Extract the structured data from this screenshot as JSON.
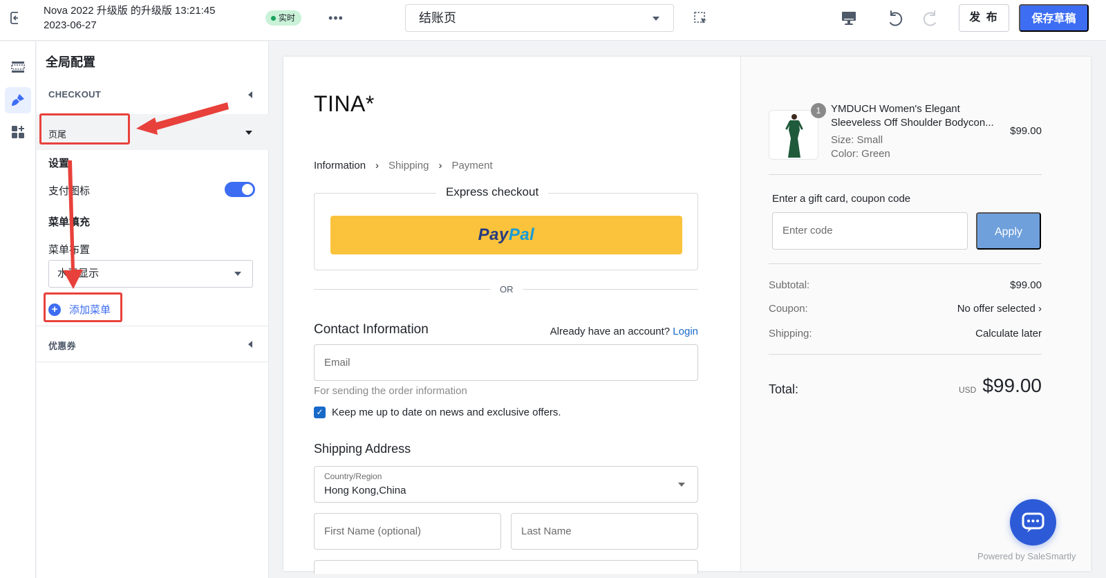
{
  "topbar": {
    "exit_icon": "exit-icon",
    "title": "Nova 2022 升级版 的升级版 13:21:45",
    "date": "2023-06-27",
    "live_badge": "实时",
    "more": "•••",
    "page_select": "结账页",
    "publish": "发 布",
    "save_draft": "保存草稿",
    "icons": [
      "select-area-icon",
      "desktop-preview-icon",
      "undo-icon",
      "redo-icon"
    ]
  },
  "rail": {
    "items": [
      "sections-icon",
      "theme-brush-icon",
      "add-app-icon"
    ]
  },
  "panel": {
    "title": "全局配置",
    "checkout_section": "CHECKOUT",
    "footer_row": "页尾",
    "settings": "设置",
    "payment_icon": "支付图标",
    "payment_icon_on": true,
    "menu_fill": "菜单填充",
    "menu_layout": "菜单布置",
    "menu_layout_value": "水平显示",
    "add_menu": "添加菜单",
    "coupon_section": "优惠券"
  },
  "checkout": {
    "brand": "TINA*",
    "breadcrumbs": [
      "Information",
      "Shipping",
      "Payment"
    ],
    "express_label": "Express checkout",
    "paypal_a": "Pay",
    "paypal_b": "Pal",
    "or": "OR",
    "contact_title": "Contact Information",
    "account_prompt": "Already have an account?",
    "login": "Login",
    "email_placeholder": "Email",
    "email_hint": "For sending the order information",
    "newsletter": "Keep me up to date on news and exclusive offers.",
    "newsletter_checked": true,
    "shipping_title": "Shipping Address",
    "country_label": "Country/Region",
    "country_value": "Hong Kong,China",
    "first_name_placeholder": "First Name (optional)",
    "last_name_placeholder": "Last Name"
  },
  "summary": {
    "qty": "1",
    "product_name": "YMDUCH Women's Elegant Sleeveless Off Shoulder Bodycon...",
    "size": "Size: Small",
    "color": "Color: Green",
    "price": "$99.00",
    "gift_label": "Enter a gift card, coupon code",
    "code_placeholder": "Enter code",
    "apply": "Apply",
    "subtotal_k": "Subtotal:",
    "subtotal_v": "$99.00",
    "coupon_k": "Coupon:",
    "coupon_v": "No offer selected",
    "shipping_k": "Shipping:",
    "shipping_v": "Calculate later",
    "total_k": "Total:",
    "currency": "USD",
    "total_v": "$99.00"
  },
  "chat": {
    "icon": "chat-bubble-icon",
    "powered": "Powered by SaleSmartly"
  },
  "colors": {
    "accent": "#3d6df2",
    "annotation": "#e8413b",
    "paypal_yellow": "#fbc33c",
    "link": "#1869c8"
  }
}
